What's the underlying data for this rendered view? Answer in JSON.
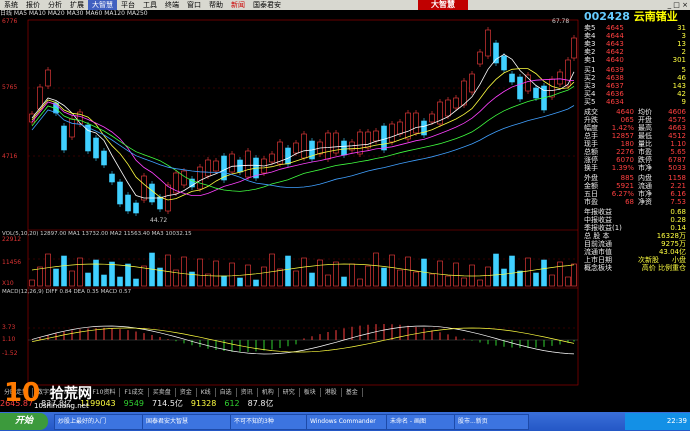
{
  "menubar": {
    "items": [
      "系统",
      "报价",
      "分析",
      "扩展",
      "大智慧",
      "平台",
      "工具",
      "终端",
      "窗口",
      "帮助"
    ],
    "active_index": 4,
    "brand": "大智慧",
    "news_label": "新闻",
    "tab_label": "国泰君安"
  },
  "infobar": {
    "text": "日线  MA5  MA10  MA20  MA30  MA60  MA120  MA250"
  },
  "axis": {
    "price_top": "6776",
    "price_mid": "5765",
    "price_low": "4716",
    "vol_top": "22912",
    "vol_mid": "11456",
    "vol_unit": "X10",
    "macd_top": "3.73",
    "macd_mid": "1.10",
    "macd_low": "-1.52",
    "low_marker": "44.72",
    "high_marker": "67.78"
  },
  "indicators": {
    "vol_label": "VOL(5,10,20)  12897.00  MA1  13732.00  MA2  11563.40  MA3  10032.15",
    "macd_label": "MACD(12,26,9)  DIFF  0.84  DEA  0.35  MACD  0.57"
  },
  "panel": {
    "code": "002428",
    "name": "云南锗业",
    "sell_labels": [
      "卖5",
      "卖4",
      "卖3",
      "卖2",
      "卖1"
    ],
    "sell_prices": [
      "4645",
      "4644",
      "4643",
      "4642",
      "4640"
    ],
    "sell_vols": [
      "31",
      "3",
      "13",
      "2",
      "301"
    ],
    "buy_labels": [
      "买1",
      "买2",
      "买3",
      "买4",
      "买5"
    ],
    "buy_prices": [
      "4639",
      "4638",
      "4637",
      "4636",
      "4634"
    ],
    "buy_vols": [
      "5",
      "46",
      "143",
      "42",
      "9"
    ],
    "stats": [
      {
        "k": "成交",
        "v": "4640",
        "k2": "均价",
        "v2": "4606"
      },
      {
        "k": "升跌",
        "v": "065",
        "k2": "开盘",
        "v2": "4575"
      },
      {
        "k": "幅度",
        "v": "1.42%",
        "k2": "最高",
        "v2": "4663"
      },
      {
        "k": "总手",
        "v": "12857",
        "k2": "最低",
        "v2": "4512"
      },
      {
        "k": "现手",
        "v": "180",
        "k2": "量比",
        "v2": "1.10"
      },
      {
        "k": "总额",
        "v": "2276",
        "k2": "市盈",
        "v2": "5.65"
      },
      {
        "k": "涨停",
        "v": "6070",
        "k2": "跌停",
        "v2": "6787"
      },
      {
        "k": "换手",
        "v": "1.39%",
        "k2": "市净",
        "v2": "5033"
      }
    ],
    "outer": {
      "k": "外盘",
      "v": "885",
      "k2": "内盘",
      "v2": "1158"
    },
    "fin": [
      {
        "k": "金额",
        "v": "5921",
        "k2": "流通",
        "v2": "2.21"
      },
      {
        "k": "五日",
        "v": "6.27%",
        "k2": "市净",
        "v2": "6.16"
      },
      {
        "k": "市盈",
        "v": "68",
        "k2": "净资",
        "v2": "7.53"
      }
    ],
    "earnings": [
      {
        "k": "年报收益",
        "v": "0.68"
      },
      {
        "k": "中报收益",
        "v": "0.28"
      },
      {
        "k": "季报收益(1)",
        "v": "0.14"
      }
    ],
    "shares": [
      {
        "k": "总 股 本",
        "v": "16328万"
      },
      {
        "k": "目前流通",
        "v": "9275万"
      },
      {
        "k": "流通市值",
        "v": "43.04亿"
      }
    ],
    "list_date": {
      "k": "上市日期",
      "v": "次新股",
      "v2": "小盘"
    },
    "concept": {
      "k": "概念板块",
      "v": "高价 比例重仓"
    }
  },
  "tabs": [
    "分时走势",
    "数字盘",
    "F1财务",
    "F10资料",
    "F1成交",
    "买卖盘",
    "资金",
    "K线",
    "自选",
    "资讯",
    "机构",
    "研究",
    "板块",
    "港股",
    "基金"
  ],
  "ticker": [
    {
      "label": "上证",
      "value": "2645.87",
      "color": "red"
    },
    {
      "label": "",
      "value": "837.8亿",
      "color": "wht"
    },
    {
      "label": "",
      "value": "1199043",
      "color": "yel"
    },
    {
      "label": "",
      "value": "9549",
      "color": "grn"
    },
    {
      "label": "",
      "value": "714.5亿",
      "color": "wht"
    },
    {
      "label": "",
      "value": "91328",
      "color": "yel"
    },
    {
      "label": "",
      "value": "612",
      "color": "grn"
    },
    {
      "label": "",
      "value": "87.8亿",
      "color": "wht"
    }
  ],
  "taskbar": {
    "start": "开始",
    "tasks": [
      "炒股上最好的入门",
      "国泰君安大智慧",
      "不可不知的3种",
      "Windows Commander",
      "未命名 - 画图",
      "股市...新页"
    ],
    "clock": "22:39"
  },
  "watermark": {
    "num": "10",
    "text": "拾荒网",
    "url": "10shihuang.net"
  }
}
